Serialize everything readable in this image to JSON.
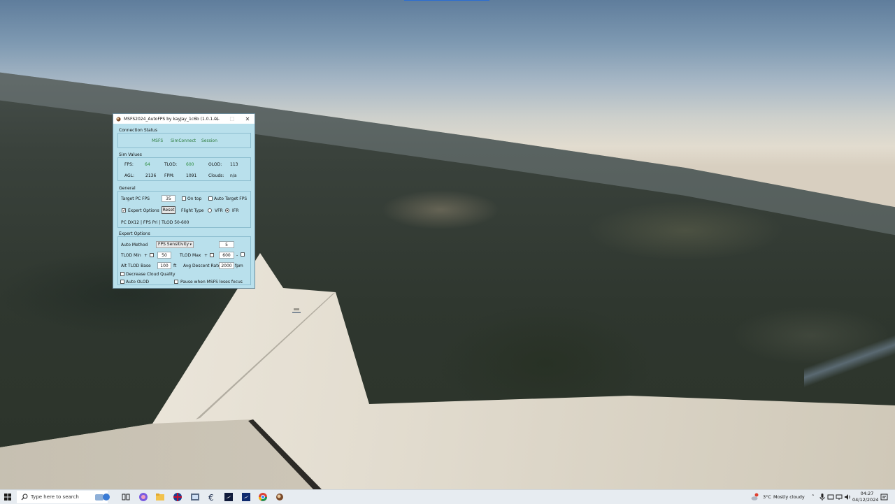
{
  "window": {
    "title": "MSFS2024_AutoFPS by kayJay_1c6b (1.0.1.0)",
    "min_glyph": "—",
    "max_glyph": "☐",
    "close_glyph": "✕"
  },
  "connection_status": {
    "title": "Connection Status",
    "items": [
      "MSFS",
      "SimConnect",
      "Session"
    ]
  },
  "sim_values": {
    "title": "Sim Values",
    "fps_label": "FPS:",
    "fps": "64",
    "tlod_label": "TLOD:",
    "tlod": "600",
    "olod_label": "OLOD:",
    "olod": "113",
    "agl_label": "AGL:",
    "agl": "2136",
    "fpm_label": "FPM:",
    "fpm": "1091",
    "clouds_label": "Clouds:",
    "clouds": "n/a"
  },
  "general": {
    "title": "General",
    "target_fps_label": "Target PC FPS",
    "target_fps": "35",
    "on_top_label": "On top",
    "auto_target_label": "Auto Target FPS",
    "expert_options_label": "Expert Options",
    "reset_label": "Reset",
    "flight_type_label": "Flight Type",
    "vfr_label": "VFR",
    "ifr_label": "IFR",
    "status_line": "PC DX12 | FPS Pri | TLOD 50-600"
  },
  "expert": {
    "title": "Expert Options",
    "auto_method_label": "Auto Method",
    "auto_method_value": "FPS Sensitivity",
    "sensitivity": "5",
    "tlod_min_label": "TLOD Min",
    "tlod_min_sign": "+",
    "tlod_min": "50",
    "tlod_max_label": "TLOD Max",
    "tlod_max_sign": "+",
    "tlod_max": "600",
    "tlod_max_dash": "-",
    "alt_tlod_base_label": "Alt TLOD Base",
    "alt_tlod_base": "100",
    "ft_unit": "ft",
    "avg_descent_label": "Avg Descent Rate",
    "avg_descent": "2000",
    "fpm_unit": "fpm",
    "decrease_cloud_label": "Decrease Cloud Quality",
    "auto_olod_label": "Auto OLOD",
    "pause_label": "Pause when MSFS loses focus"
  },
  "taskbar": {
    "search_placeholder": "Type here to search",
    "weather_temp": "3°C",
    "weather_desc": "Mostly cloudy",
    "time": "04:27",
    "date": "04/12/2024"
  },
  "colors": {
    "window_bg": "#b9e0ec",
    "value_green": "#2a8a3a",
    "taskbar_bg": "#e7ecf1"
  }
}
